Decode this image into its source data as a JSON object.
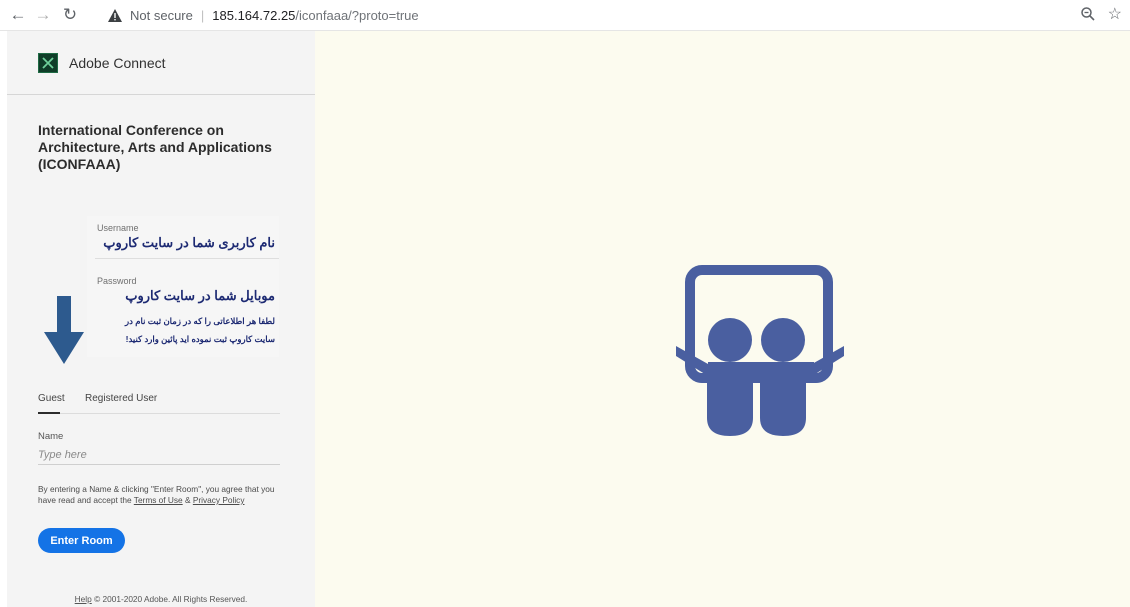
{
  "browser": {
    "back_icon": "arrow-left",
    "forward_icon": "arrow-right",
    "reload_icon": "reload",
    "security_label": "Not secure",
    "separator": "|",
    "url_host": "185.164.72.25",
    "url_path": "/iconfaaa/?proto=true",
    "star_icon": "star"
  },
  "app": {
    "brand_name": "Adobe Connect",
    "room_title": "International Conference on Architecture, Arts and Applications (ICONFAAA)"
  },
  "overlay": {
    "username_label": "Username",
    "username_value": "نام کاربری شما در سایت کاروپ",
    "password_label": "Password",
    "password_value": "موبایل شما در سایت کاروپ",
    "note_line1": "لطفا هر اطلاعاتی را که در زمان ثبت نام در",
    "note_line2": "سایت کاروپ ثبت نموده اید پائین وارد کنید!"
  },
  "login": {
    "tabs": [
      {
        "label": "Guest",
        "active": true
      },
      {
        "label": "Registered User",
        "active": false
      }
    ],
    "name_label": "Name",
    "name_placeholder": "Type here",
    "agree_text_1": "By entering a Name & clicking \"Enter Room\", you agree that you have read and accept the",
    "terms_link": "Terms of Use",
    "amp": "&",
    "privacy_link": "Privacy Policy",
    "enter_button": "Enter Room"
  },
  "footer": {
    "help_link": "Help",
    "copyright": "© 2001-2020 Adobe. All Rights Reserved."
  },
  "colors": {
    "accent_blue": "#1473e6",
    "logo_blue": "#4a5fa0",
    "arrow_blue": "#2d5a8e",
    "right_background": "#fcfbef",
    "overlay_text": "#1d2a73"
  }
}
